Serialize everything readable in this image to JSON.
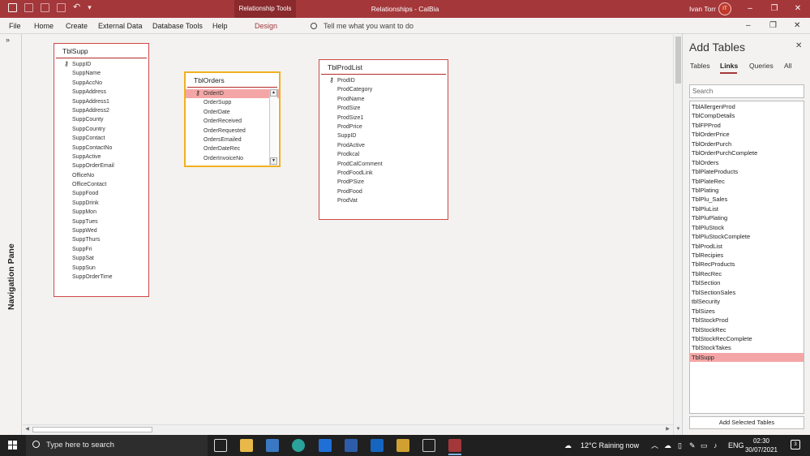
{
  "window": {
    "title": "Relationships - CalBia",
    "context_tab": "Relationship Tools",
    "user_name": "Ivan Torr",
    "user_initials": "IT",
    "accent": "#a4373a"
  },
  "ribbon": {
    "tabs": [
      "File",
      "Home",
      "Create",
      "External Data",
      "Database Tools",
      "Help",
      "Design"
    ],
    "tell_me": "Tell me what you want to do"
  },
  "nav_pane": {
    "label": "Navigation Pane"
  },
  "tables": {
    "tblsupp": {
      "name": "TblSupp",
      "fields": [
        "SuppID",
        "SuppName",
        "SuppAccNo",
        "SuppAddress",
        "SuppAddress1",
        "SuppAddress2",
        "SuppCounty",
        "SuppCountry",
        "SuppContact",
        "SuppContactNo",
        "SuppActive",
        "SuppOrderEmail",
        "OfficeNo",
        "OfficeContact",
        "SuppFood",
        "SuppDrink",
        "SuppMon",
        "SuppTues",
        "SuppWed",
        "SuppThurs",
        "SuppFri",
        "SuppSat",
        "SuppSun",
        "SuppOrderTime"
      ]
    },
    "tblorders": {
      "name": "TblOrders",
      "fields": [
        "OrderID",
        "OrderSupp",
        "OrderDate",
        "OrderReceived",
        "OrderRequested",
        "OrdersEmailed",
        "OrderDateRec",
        "OrderInvoiceNo"
      ]
    },
    "tblprodlist": {
      "name": "TblProdList",
      "fields": [
        "ProdID",
        "ProdCategory",
        "ProdName",
        "ProdSize",
        "ProdSize1",
        "ProdPrice",
        "SuppID",
        "ProdActive",
        "Prodkcal",
        "ProdCalComment",
        "ProdFoodLink",
        "ProdPSize",
        "ProdFood",
        "ProdVat"
      ]
    }
  },
  "add_tables": {
    "title": "Add Tables",
    "tabs": [
      "Tables",
      "Links",
      "Queries",
      "All"
    ],
    "active_tab": "Links",
    "search_placeholder": "Search",
    "items": [
      "TblAllergenProd",
      "TblCompDetails",
      "TblFPProd",
      "TblOrderPrice",
      "TblOrderPurch",
      "TblOrderPurchComplete",
      "TblOrders",
      "TblPlateProducts",
      "TblPlateRec",
      "TblPlating",
      "TblPlu_Sales",
      "TblPluList",
      "TblPluPlating",
      "TblPluStock",
      "TblPluStockComplete",
      "TblProdList",
      "TblRecipies",
      "TblRecProducts",
      "TblRecRec",
      "TblSection",
      "TblSectionSales",
      "tblSecurity",
      "TblSizes",
      "TblStockProd",
      "TblStockRec",
      "TblStockRecComplete",
      "TblStockTakes",
      "TblSupp"
    ],
    "selected_item": "TblSupp",
    "add_button": "Add Selected Tables"
  },
  "taskbar": {
    "search_placeholder": "Type here to search",
    "weather": "12°C  Raining now",
    "language": "ENG",
    "time": "02:30",
    "date": "30/07/2021",
    "notifications": "3"
  }
}
